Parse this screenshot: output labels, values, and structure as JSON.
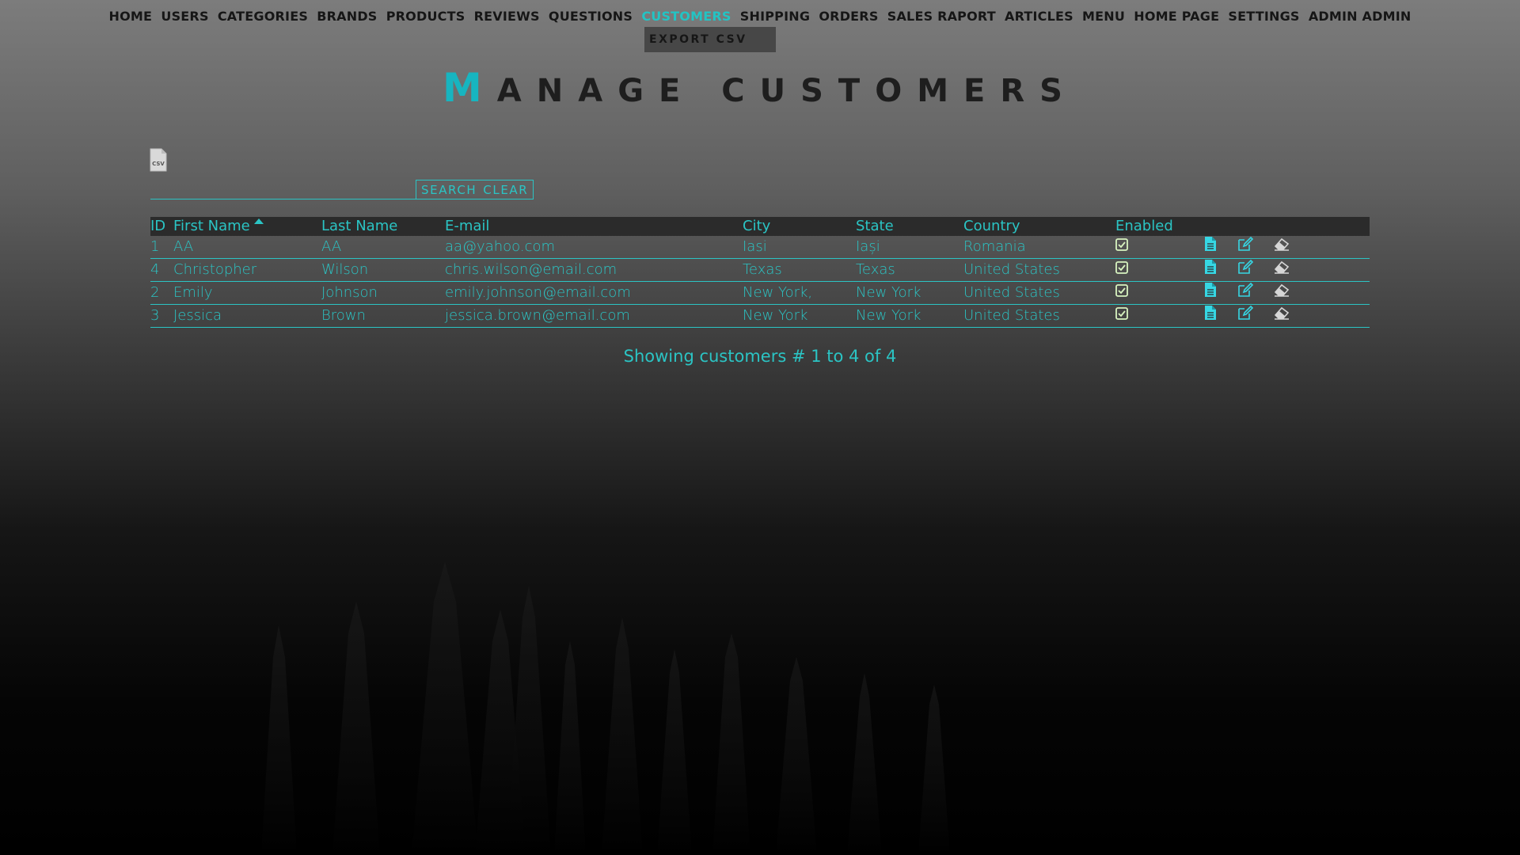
{
  "nav": {
    "items": [
      {
        "label": "HOME",
        "active": false
      },
      {
        "label": "USERS",
        "active": false
      },
      {
        "label": "CATEGORIES",
        "active": false
      },
      {
        "label": "BRANDS",
        "active": false
      },
      {
        "label": "PRODUCTS",
        "active": false
      },
      {
        "label": "REVIEWS",
        "active": false
      },
      {
        "label": "QUESTIONS",
        "active": false
      },
      {
        "label": "CUSTOMERS",
        "active": true
      },
      {
        "label": "SHIPPING",
        "active": false
      },
      {
        "label": "ORDERS",
        "active": false
      },
      {
        "label": "SALES RAPORT",
        "active": false
      },
      {
        "label": "ARTICLES",
        "active": false
      },
      {
        "label": "MENU",
        "active": false
      },
      {
        "label": "HOME PAGE",
        "active": false
      },
      {
        "label": "SETTINGS",
        "active": false
      },
      {
        "label": "ADMIN ADMIN",
        "active": false
      }
    ],
    "dropdown_item": "EXPORT CSV"
  },
  "page": {
    "title_first": "M",
    "title_rest": "ANAGE CUSTOMERS",
    "export_icon": "csv-file-icon"
  },
  "search": {
    "value": "",
    "placeholder": "",
    "search_label": "SEARCH",
    "clear_label": "CLEAR"
  },
  "table": {
    "headers": {
      "id": "ID",
      "first_name": "First Name",
      "last_name": "Last Name",
      "email": "E-mail",
      "city": "City",
      "state": "State",
      "country": "Country",
      "enabled": "Enabled"
    },
    "sorted_column": "first_name",
    "sort_direction": "asc",
    "rows": [
      {
        "id": "1",
        "first_name": "AA",
        "last_name": "AA",
        "email": "aa@yahoo.com",
        "city": "Iasi",
        "state": "Iași",
        "country": "Romania",
        "enabled": true
      },
      {
        "id": "4",
        "first_name": "Christopher",
        "last_name": "Wilson",
        "email": "chris.wilson@email.com",
        "city": "Texas",
        "state": "Texas",
        "country": "United States",
        "enabled": true
      },
      {
        "id": "2",
        "first_name": "Emily",
        "last_name": "Johnson",
        "email": "emily.johnson@email.com",
        "city": "New York,",
        "state": "New York",
        "country": "United States",
        "enabled": true
      },
      {
        "id": "3",
        "first_name": "Jessica",
        "last_name": "Brown",
        "email": "jessica.brown@email.com",
        "city": "New York",
        "state": "New York",
        "country": "United States",
        "enabled": true
      }
    ],
    "row_actions": [
      "details-icon",
      "edit-icon",
      "delete-icon"
    ]
  },
  "summary": "Showing customers # 1 to 4 of 4",
  "colors": {
    "accent": "#2bc4c4",
    "nav_text": "#161616",
    "title_accent": "#17b5c0",
    "header_bg": "#2b2b2b",
    "checkbox": "#d8f4c0"
  }
}
